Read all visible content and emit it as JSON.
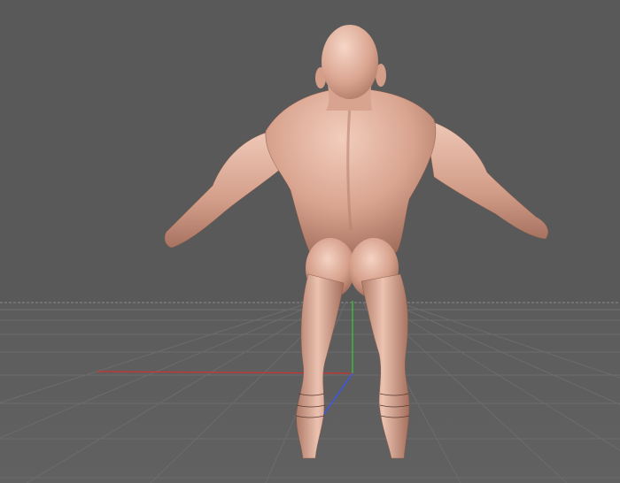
{
  "viewport": {
    "background_color": "#595959",
    "floor_color": "#5e5e5e",
    "grid_line_color": "#6c6c6c",
    "horizon_line_color": "#8a8a8a",
    "skin_base_color": "#d9a48f",
    "skin_highlight_color": "#f4d0c0",
    "skin_shadow_color": "#9c6a58"
  },
  "scene": {
    "object": "humanoid-muscular-character-back-view",
    "axes": {
      "x_axis_color": "#cc3333",
      "y_axis_color": "#33cc33",
      "z_axis_color": "#3355ff"
    },
    "grid": {
      "visible": true,
      "style": "perspective-floor"
    }
  }
}
